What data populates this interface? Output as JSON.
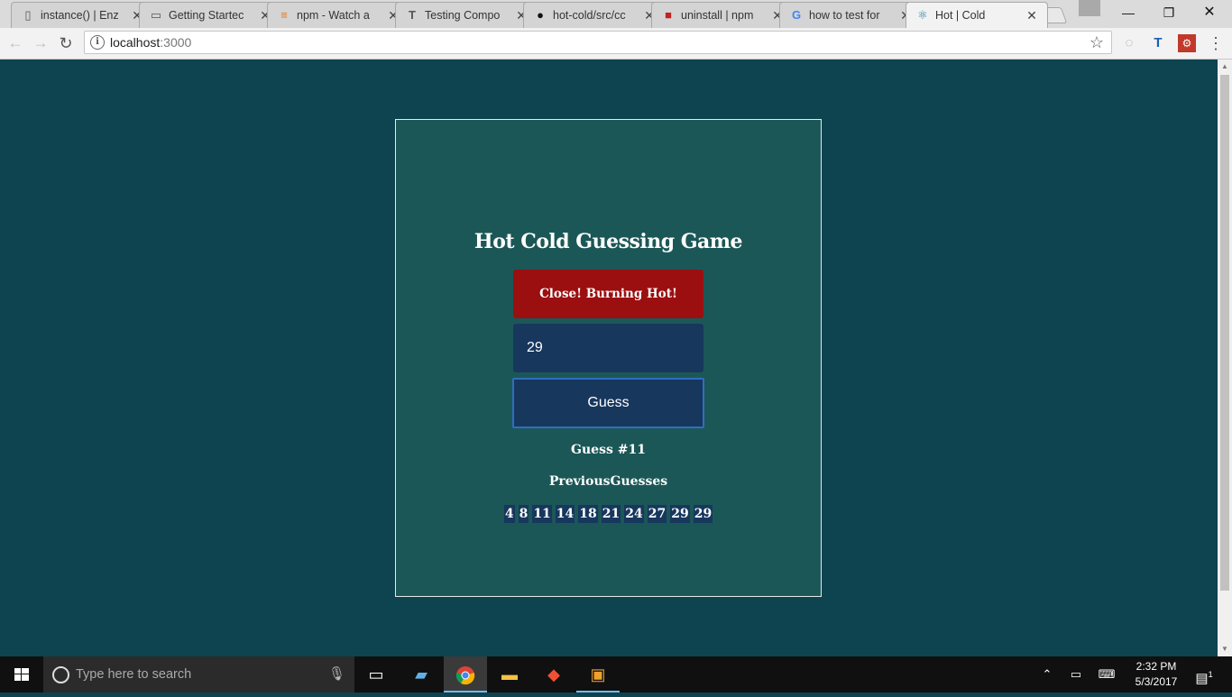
{
  "browser": {
    "tabs": [
      {
        "title": "instance() | Enz",
        "icon": "book-icon"
      },
      {
        "title": "Getting Startec",
        "icon": "page-icon"
      },
      {
        "title": "npm - Watch a",
        "icon": "stackoverflow-icon"
      },
      {
        "title": "Testing Compo",
        "icon": "tutsplus-icon"
      },
      {
        "title": "hot-cold/src/cc",
        "icon": "github-icon"
      },
      {
        "title": "uninstall | npm",
        "icon": "npm-icon"
      },
      {
        "title": "how to test for",
        "icon": "google-icon"
      },
      {
        "title": "Hot | Cold",
        "icon": "react-icon"
      }
    ],
    "close_glyph": "✕",
    "url_host": "localhost",
    "url_port": ":3000",
    "window_controls": {
      "minimize": "—",
      "restore": "❐",
      "close": "✕"
    }
  },
  "game": {
    "title": "Hot Cold Guessing Game",
    "feedback": "Close! Burning Hot!",
    "input_value": "29",
    "guess_button": "Guess",
    "guess_count": "Guess #11",
    "previous_label": "PreviousGuesses",
    "previous_guesses": [
      "4",
      "8",
      "11",
      "14",
      "18",
      "21",
      "24",
      "27",
      "29",
      "29"
    ]
  },
  "taskbar": {
    "search_placeholder": "Type here to search",
    "time": "2:32 PM",
    "date": "5/3/2017",
    "notification_count": "1"
  },
  "colors": {
    "page_bg": "#0e4450",
    "card_bg": "#1c5757",
    "feedback_bg": "#9b0f10",
    "input_bg": "#17375d",
    "button_border": "#2e6ec0"
  }
}
